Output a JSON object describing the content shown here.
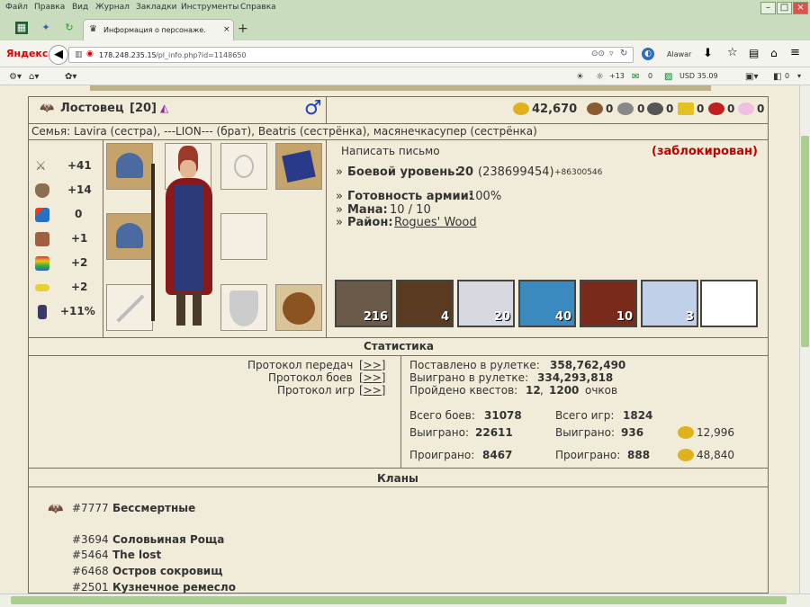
{
  "browser": {
    "menu": [
      "Файл",
      "Правка",
      "Вид",
      "Журнал",
      "Закладки",
      "Инструменты",
      "Справка"
    ],
    "tab_title": "Информация о персонаже.",
    "new_tab": "+",
    "logo": "Яндекс",
    "url_host": "178.248.235.15",
    "url_path": "/pl_info.php?id=1148650",
    "profile_name": "Alawar",
    "bm_count": "+13",
    "bm_mail": "0",
    "bm_rate": "USD 35.09",
    "bm_weather": "0"
  },
  "player": {
    "name": "Лостовец",
    "level": "[20]",
    "gender_symbol": "♂",
    "gold": "42,670",
    "res_values": [
      "0",
      "0",
      "0",
      "0",
      "0",
      "0"
    ],
    "family": "Семья: Lavira (сестра), ---LION--- (брат), Beatris (сестрёнка), масянечкасупер (сестрёнка)"
  },
  "stats": {
    "attack": "+41",
    "defense": "+14",
    "spell": "0",
    "knowledge": "+1",
    "luck": "+2",
    "morale": "+2",
    "initiative": "+11%"
  },
  "info": {
    "write_letter": "Написать письмо",
    "blocked": "(заблокирован)",
    "combat_label": "Боевой уровень:",
    "combat_value": "20",
    "combat_exp": "(238699454)",
    "combat_delta": "+86300546",
    "army_label": "Готовность армии:",
    "army_value": "100%",
    "mana_label": "Мана:",
    "mana_value": "10 / 10",
    "district_label": "Район:",
    "district_value": "Rogues' Wood",
    "bullet": "»"
  },
  "army": [
    "216",
    "4",
    "20",
    "40",
    "10",
    "3",
    ""
  ],
  "statistics": {
    "title": "Статистика",
    "protocols": [
      "Протокол передач",
      "Протокол боев",
      "Протокол игр"
    ],
    "protocol_link": "[>>]",
    "roulette_bet_label": "Поставлено в рулетке:",
    "roulette_bet": "358,762,490",
    "roulette_win_label": "Выиграно в рулетке:",
    "roulette_win": "334,293,818",
    "quests_label": "Пройдено квестов:",
    "quests_value": "12",
    "quests_points": "1200",
    "quests_suffix": "очков",
    "battles_label": "Всего боев:",
    "battles": "31078",
    "games_label": "Всего игр:",
    "games": "1824",
    "won_label": "Выиграно:",
    "battles_won": "22611",
    "games_won": "936",
    "gold_won": "12,996",
    "lost_label": "Проиграно:",
    "battles_lost": "8467",
    "games_lost": "888",
    "gold_lost": "48,840"
  },
  "clans": {
    "title": "Кланы",
    "main": {
      "id": "#7777",
      "name": "Бессмертные"
    },
    "list": [
      {
        "id": "#3694",
        "name": "Соловьиная Роща"
      },
      {
        "id": "#5464",
        "name": "The lost"
      },
      {
        "id": "#6468",
        "name": "Остров сокровищ"
      },
      {
        "id": "#2501",
        "name": "Кузнечное ремесло"
      }
    ]
  },
  "colors": {
    "accent_red": "#c00000",
    "border": "#7a6e5a",
    "brand_green": "#a8cf8e"
  }
}
